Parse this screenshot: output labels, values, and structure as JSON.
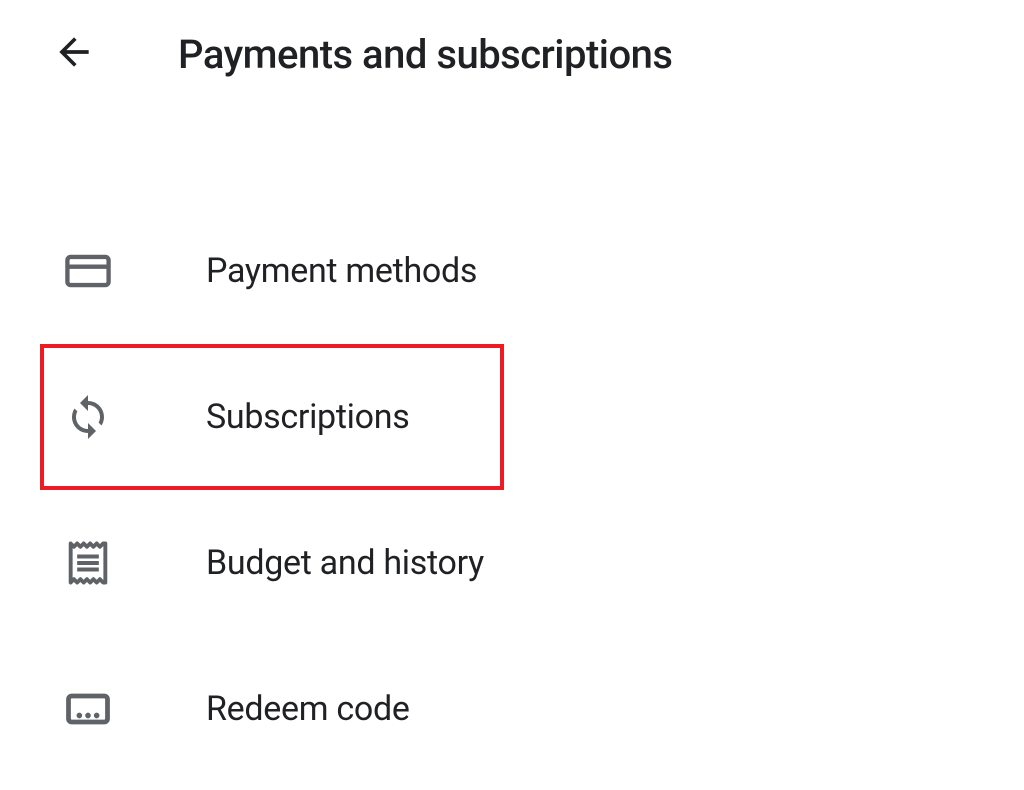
{
  "header": {
    "title": "Payments and subscriptions"
  },
  "menu": {
    "items": [
      {
        "label": "Payment methods",
        "icon": "credit-card-icon",
        "highlighted": false
      },
      {
        "label": "Subscriptions",
        "icon": "sync-icon",
        "highlighted": true
      },
      {
        "label": "Budget and history",
        "icon": "receipt-icon",
        "highlighted": false
      },
      {
        "label": "Redeem code",
        "icon": "redeem-icon",
        "highlighted": false
      }
    ]
  },
  "highlight_color": "#ed1c24",
  "icon_color": "#5f6368"
}
